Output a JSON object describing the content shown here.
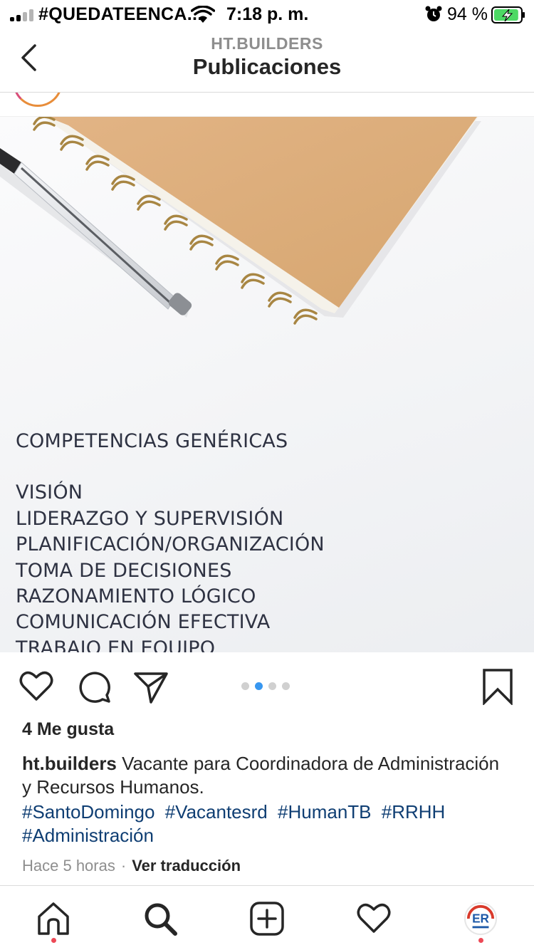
{
  "status_bar": {
    "carrier": "#QUEDATEENCA...",
    "time": "7:18 p. m.",
    "battery_percent": "94 %",
    "battery_level": 0.94,
    "icons": [
      "signal-icon",
      "wifi-icon",
      "alarm-icon",
      "battery-charging-icon"
    ]
  },
  "nav": {
    "subtitle": "HT.BUILDERS",
    "title": "Publicaciones",
    "back_icon": "chevron-left-icon"
  },
  "post": {
    "image_text": {
      "heading": "COMPETENCIAS GENÉRICAS",
      "items": [
        "VISIÓN",
        "LIDERAZGO Y SUPERVISIÓN",
        "PLANIFICACIÓN/ORGANIZACIÓN",
        "TOMA DE DECISIONES",
        "RAZONAMIENTO LÓGICO",
        "COMUNICACIÓN EFECTIVA",
        "TRABAJO EN EQUIPO"
      ]
    },
    "carousel": {
      "total": 4,
      "active_index": 1
    },
    "actions": [
      "heart-icon",
      "comment-icon",
      "share-icon",
      "bookmark-icon"
    ],
    "likes": "4 Me gusta",
    "caption": {
      "username": "ht.builders",
      "text": "Vacante para Coordinadora de Administración y Recursos Humanos."
    },
    "hashtags": [
      "#SantoDomingo",
      "#Vacantesrd",
      "#HumanTB",
      "#RRHH",
      "#Administración"
    ],
    "timestamp": "Hace 5 horas",
    "separator": "·",
    "translate_label": "Ver traducción"
  },
  "tabbar": {
    "tabs": [
      "home-icon",
      "search-icon",
      "new-post-icon",
      "activity-icon",
      "profile-avatar"
    ],
    "profile_initials": "ER"
  },
  "colors": {
    "link": "#0f3e73",
    "active_dot": "#3897f0",
    "notification": "#ed4956",
    "battery": "#4cd964"
  }
}
